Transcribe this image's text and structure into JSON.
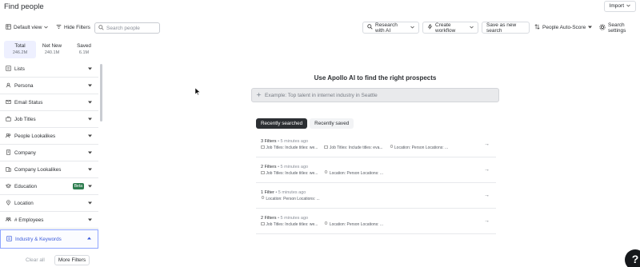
{
  "header": {
    "title": "Find people",
    "import_label": "Import"
  },
  "toolbar": {
    "default_view": "Default view",
    "hide_filters": "Hide Filters",
    "search_placeholder": "Search people",
    "research_ai": "Research with AI",
    "create_workflow": "Create workflow",
    "save_search": "Save as new search",
    "auto_score": "People Auto-Score",
    "search_settings": "Search settings"
  },
  "counts": [
    {
      "label": "Total",
      "value": "246.2M",
      "active": true
    },
    {
      "label": "Net New",
      "value": "240.1M",
      "active": false
    },
    {
      "label": "Saved",
      "value": "6.1M",
      "active": false
    }
  ],
  "filters": [
    {
      "label": "Lists",
      "icon": "list-icon"
    },
    {
      "label": "Persona",
      "icon": "persona-icon"
    },
    {
      "label": "Email Status",
      "icon": "mail-icon"
    },
    {
      "label": "Job Titles",
      "icon": "briefcase-icon"
    },
    {
      "label": "People Lookalikes",
      "icon": "people-icon"
    },
    {
      "label": "Company",
      "icon": "building-icon"
    },
    {
      "label": "Company Lookalikes",
      "icon": "building-lookalike-icon"
    },
    {
      "label": "Education",
      "icon": "graduation-icon",
      "badge": "Beta"
    },
    {
      "label": "Location",
      "icon": "pin-icon"
    },
    {
      "label": "# Employees",
      "icon": "employees-icon"
    },
    {
      "label": "Industry & Keywords",
      "icon": "industry-icon",
      "active": true
    }
  ],
  "bottom": {
    "clear_all": "Clear all",
    "more_filters": "More Filters"
  },
  "ai_panel": {
    "heading": "Use Apollo AI to find the right prospects",
    "placeholder": "Example: Top talent in internet industry in Seattle",
    "tab_recent_searched": "Recently searched",
    "tab_recent_saved": "Recently saved"
  },
  "recent_searches": [
    {
      "count": "3 Filters",
      "time": "• 5 minutes ago",
      "details": [
        "Job Titles: Include titles: we...",
        "Job Titles: Include titles: eva...",
        "Location: Person Locations: ..."
      ]
    },
    {
      "count": "2 Filters",
      "time": "• 5 minutes ago",
      "details": [
        "Job Titles: Include titles: we...",
        "Location: Person Locations: ..."
      ]
    },
    {
      "count": "1 Filter",
      "time": "• 5 minutes ago",
      "details": [
        "Location: Person Locations: ..."
      ]
    },
    {
      "count": "2 Filters",
      "time": "• 5 minutes ago",
      "details": [
        "Job Titles: Include titles: we...",
        "Location: Person Locations: ..."
      ]
    }
  ],
  "help_label": "?",
  "colors": {
    "accent_bg": "#eef0ff",
    "active_border": "#8fa6ff",
    "beta_badge": "#2e7d4f",
    "dark_tab": "#2c2f33"
  }
}
